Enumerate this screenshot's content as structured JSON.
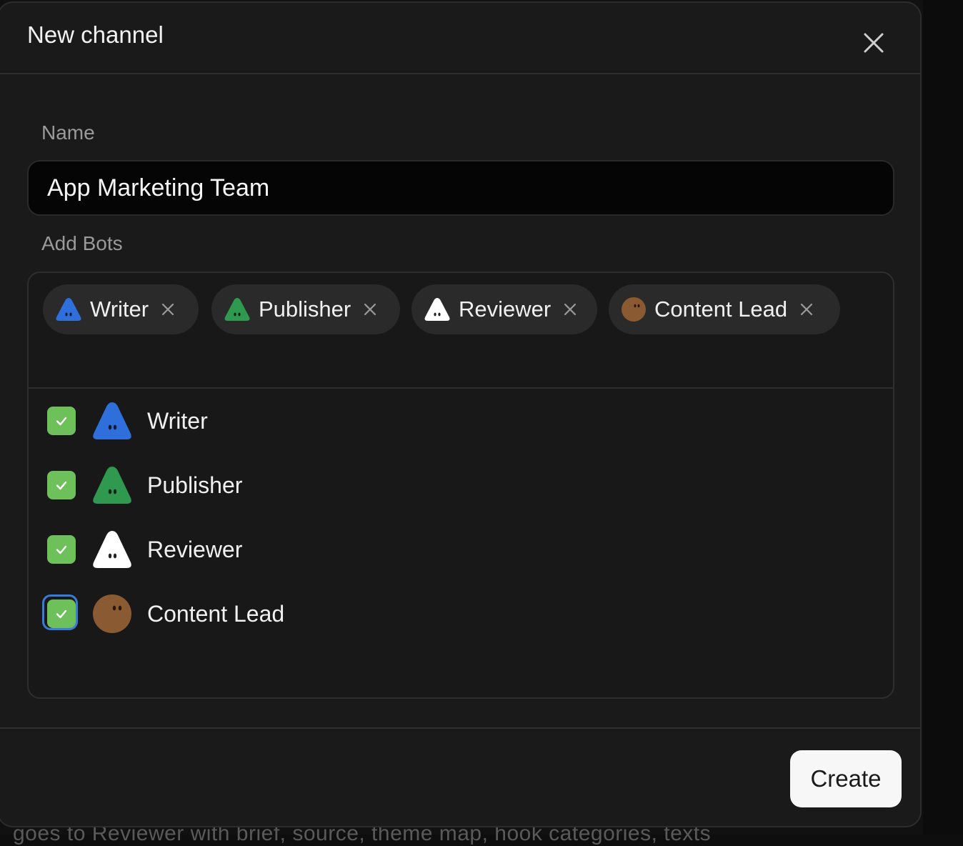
{
  "dialog": {
    "title": "New channel",
    "close_icon": "close-icon"
  },
  "name_field": {
    "label": "Name",
    "value": "App Marketing Team"
  },
  "bots_field": {
    "label": "Add Bots",
    "selected_chips": [
      {
        "label": "Writer",
        "avatar_color": "#2f6fdc",
        "avatar_shape": "triangle"
      },
      {
        "label": "Publisher",
        "avatar_color": "#2f9a4f",
        "avatar_shape": "triangle"
      },
      {
        "label": "Reviewer",
        "avatar_color": "#ffffff",
        "avatar_shape": "triangle"
      },
      {
        "label": "Content Lead",
        "avatar_color": "#8a5a32",
        "avatar_shape": "circle"
      }
    ],
    "options": [
      {
        "label": "Writer",
        "checked": true,
        "avatar_color": "#2f6fdc",
        "avatar_shape": "triangle"
      },
      {
        "label": "Publisher",
        "checked": true,
        "avatar_color": "#2f9a4f",
        "avatar_shape": "triangle"
      },
      {
        "label": "Reviewer",
        "checked": true,
        "avatar_color": "#ffffff",
        "avatar_shape": "triangle"
      },
      {
        "label": "Content Lead",
        "checked": true,
        "focused": true,
        "avatar_color": "#8a5a32",
        "avatar_shape": "circle"
      }
    ]
  },
  "footer": {
    "create_label": "Create"
  },
  "background": {
    "partial_text": "goes to Reviewer with brief, source, theme map, hook categories, texts"
  },
  "colors": {
    "checkbox_green": "#6ec05a",
    "focus_ring": "#3a7bd5",
    "dialog_bg": "#1a1a1a"
  }
}
